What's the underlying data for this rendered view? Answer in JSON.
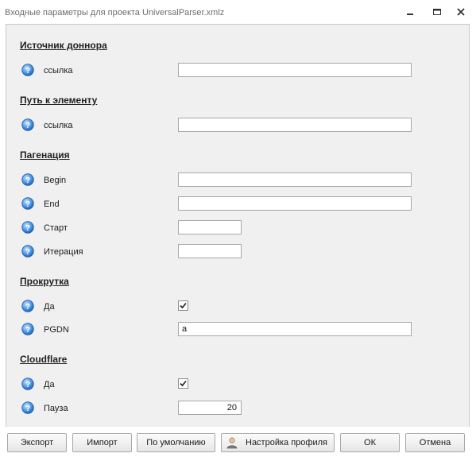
{
  "window": {
    "title": "Входные параметры для проекта UniversalParser.xmlz"
  },
  "sections": {
    "donor": {
      "title": "Источник доннора",
      "link_label": "ссылка",
      "link_value": ""
    },
    "element_path": {
      "title": "Путь к элементу",
      "link_label": "ссылка",
      "link_value": ""
    },
    "pagination": {
      "title": "Пагенация",
      "begin_label": "Begin",
      "begin_value": "",
      "end_label": "End",
      "end_value": "",
      "start_label": "Старт",
      "start_value": "",
      "iteration_label": "Итерация",
      "iteration_value": ""
    },
    "scroll": {
      "title": "Прокрутка",
      "yes_label": "Да",
      "yes_checked": true,
      "pgdn_label": "PGDN",
      "pgdn_value": "a"
    },
    "cloudflare": {
      "title": "Cloudflare",
      "yes_label": "Да",
      "yes_checked": true,
      "pause_label": "Пауза",
      "pause_value": "20"
    }
  },
  "buttons": {
    "export": "Экспорт",
    "import": "Импорт",
    "default": "По умолчанию",
    "profile": "Настройка профиля",
    "ok": "ОК",
    "cancel": "Отмена"
  },
  "icons": {
    "help": "help-circle-icon",
    "profile": "user-icon"
  },
  "colors": {
    "help_blue": "#2f7fd6",
    "panel_bg": "#f0f0f0"
  }
}
